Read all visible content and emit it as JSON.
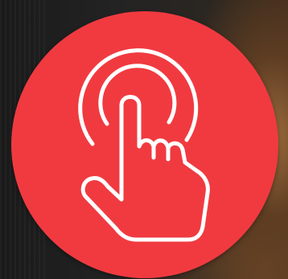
{
  "button": {
    "icon": "tap-gesture-icon",
    "background_color": "#F03A40",
    "icon_color": "#FFFFFF"
  }
}
